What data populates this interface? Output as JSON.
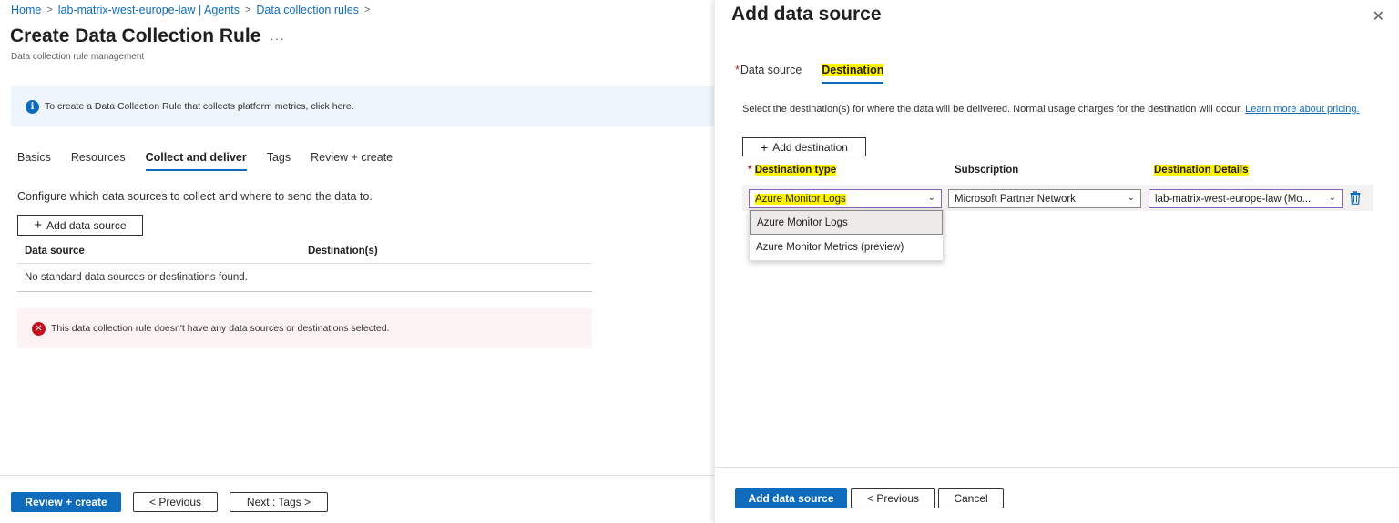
{
  "breadcrumb": {
    "home": "Home",
    "workspace": "lab-matrix-west-europe-law | Agents",
    "rules": "Data collection rules",
    "separator": ">"
  },
  "page": {
    "title": "Create Data Collection Rule",
    "more": "···",
    "subtitle": "Data collection rule management"
  },
  "info_banner": {
    "icon": "info-icon",
    "text": "To create a Data Collection Rule that collects platform metrics, click here."
  },
  "tabs": [
    "Basics",
    "Resources",
    "Collect and deliver",
    "Tags",
    "Review + create"
  ],
  "active_tab": "Collect and deliver",
  "collect": {
    "description": "Configure which data sources to collect and where to send the data to.",
    "add_button": "Add data source",
    "table": {
      "col_source": "Data source",
      "col_dest": "Destination(s)",
      "empty": "No standard data sources or destinations found."
    }
  },
  "error_banner": {
    "icon": "error-icon",
    "text": "This data collection rule doesn't have any data sources or destinations selected."
  },
  "footer": {
    "review": "Review + create",
    "previous": "< Previous",
    "next": "Next : Tags >"
  },
  "panel": {
    "title": "Add data source",
    "close": "✕",
    "tabs": {
      "data_source": "Data source",
      "destination": "Destination"
    },
    "required_mark": "*",
    "description": "Select the destination(s) for where the data will be delivered. Normal usage charges for the destination will occur.",
    "learn_more": "Learn more about pricing.",
    "add_destination": "Add destination",
    "columns": {
      "type": "Destination type",
      "subscription": "Subscription",
      "details": "Destination Details"
    },
    "row": {
      "type": "Azure Monitor Logs",
      "subscription": "Microsoft Partner Network",
      "details": "lab-matrix-west-europe-law (Mo..."
    },
    "dropdown_options": [
      "Azure Monitor Logs",
      "Azure Monitor Metrics (preview)"
    ],
    "footer": {
      "add": "Add data source",
      "previous": "< Previous",
      "cancel": "Cancel"
    }
  },
  "colors": {
    "accent": "#0f6cbd",
    "highlight": "#fff100",
    "error": "#c50f1f"
  }
}
